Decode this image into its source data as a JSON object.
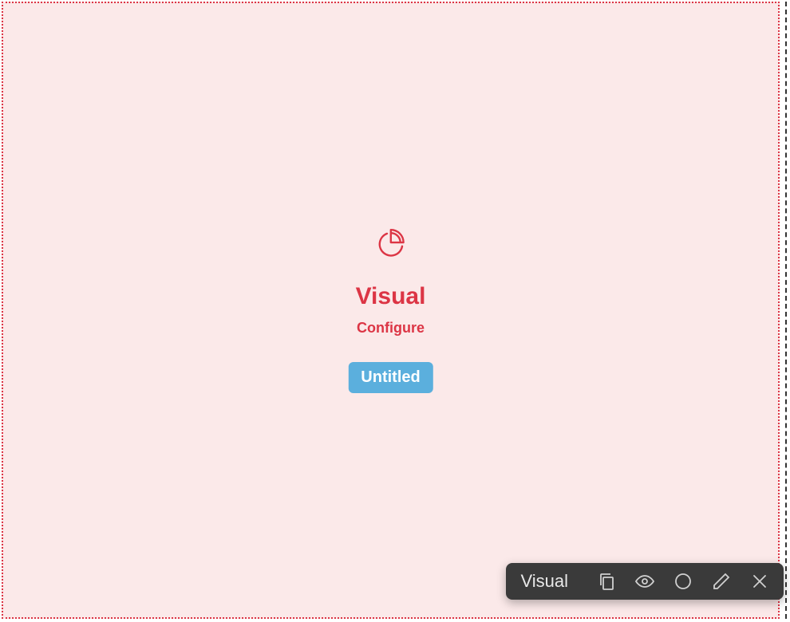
{
  "canvas": {
    "widget_type": "Visual",
    "configure_label": "Configure",
    "name": "Untitled"
  },
  "toolbar": {
    "label": "Visual"
  },
  "colors": {
    "accent_red": "#dc3545",
    "canvas_bg": "#fbe9e9",
    "badge_blue": "#5bafdd",
    "toolbar_bg": "#3a3a3a"
  }
}
